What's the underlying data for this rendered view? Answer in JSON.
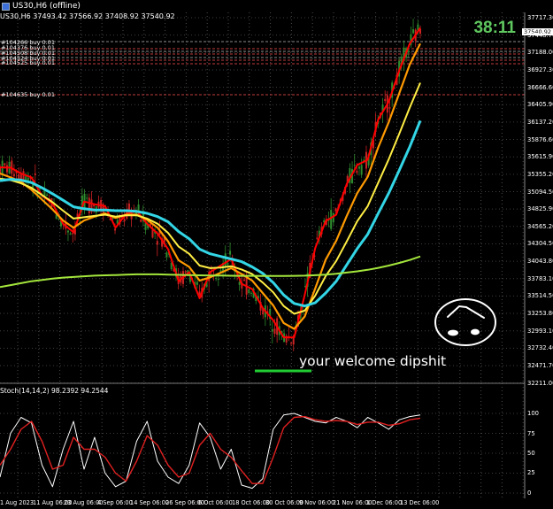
{
  "window": {
    "title": "US30,H6 (offline)",
    "ohlc": "US30,H6  37493.42 37566.92 37408.92 37540.92"
  },
  "timer": "38:11",
  "current_price": "37540.92",
  "order_labels": [
    "#104266 buy 0.01",
    "#104376 buy 0.01",
    "#104508 buy 0.01",
    "#104524 buy 0.01",
    "#104525 buy 0.01",
    "#104635 buy 0.01"
  ],
  "caption": "your welcome dipshit",
  "stoch_label": "Stoch(14,14,2) 98.2392 94.2544",
  "colors": {
    "background": "#000000",
    "up_candle": "#2e8b2e",
    "down_candle": "#cc2222",
    "ema_fast": "#ff0000",
    "ema_mid": "#ff9a00",
    "ema_slow": "#ffee44",
    "ma_cyan": "#33d6e6",
    "ma_long": "#a4e63c",
    "stoch_main": "#ffffff",
    "stoch_signal": "#e02020",
    "annotation": "#22cc33",
    "timer": "#5fc85f"
  },
  "chart_data": [
    {
      "type": "line",
      "title": "US30,H6 (offline)",
      "xlabel": "",
      "ylabel": "",
      "x_ticks": [
        "1 Aug 2023",
        "11 Aug 06:00",
        "23 Aug 06:00",
        "4 Sep 06:00",
        "14 Sep 06:00",
        "26 Sep 06:00",
        "6 Oct 06:00",
        "18 Oct 06:00",
        "30 Oct 06:00",
        "9 Nov 06:00",
        "21 Nov 06:00",
        "1 Dec 06:00",
        "13 Dec 06:00"
      ],
      "y_ticks": [
        "37717.30",
        "37448.70",
        "37188.00",
        "36927.30",
        "36666.60",
        "36405.90",
        "36137.20",
        "35876.60",
        "35615.90",
        "35355.20",
        "35094.50",
        "34825.90",
        "34565.20",
        "34304.50",
        "34043.80",
        "33783.10",
        "33514.50",
        "33253.80",
        "32993.10",
        "32732.40",
        "32471.70",
        "32211.00"
      ],
      "ylim": [
        32211,
        37717
      ],
      "series": [
        {
          "values": [
            35425,
            35420,
            35330,
            35270,
            34990,
            34870,
            34560,
            34430,
            34900,
            34860,
            34830,
            34500,
            34710,
            34760,
            34560,
            34410,
            34170,
            33680,
            33820,
            33420,
            33820,
            33920,
            34020,
            33640,
            33560,
            33270,
            33080,
            32820,
            32820,
            33470,
            34190,
            34600,
            34700,
            35170,
            35460,
            35540,
            36160,
            36430,
            36910,
            37320,
            37560
          ]
        },
        {
          "values": [
            35330,
            35270,
            35200,
            35080,
            34930,
            34780,
            34610,
            34500,
            34610,
            34670,
            34720,
            34650,
            34700,
            34700,
            34620,
            34500,
            34290,
            34000,
            33900,
            33690,
            33740,
            33810,
            33880,
            33790,
            33690,
            33500,
            33310,
            33040,
            32950,
            33140,
            33570,
            34010,
            34300,
            34680,
            35030,
            35280,
            35730,
            36120,
            36560,
            37000,
            37320
          ]
        },
        {
          "values": [
            35250,
            35230,
            35180,
            35110,
            35000,
            34890,
            34760,
            34640,
            34660,
            34680,
            34700,
            34670,
            34690,
            34690,
            34640,
            34560,
            34420,
            34210,
            34100,
            33920,
            33880,
            33890,
            33910,
            33860,
            33790,
            33660,
            33510,
            33300,
            33180,
            33230,
            33460,
            33760,
            33990,
            34290,
            34600,
            34830,
            35190,
            35550,
            35940,
            36340,
            36720
          ]
        },
        {
          "values": [
            35220,
            35240,
            35230,
            35190,
            35110,
            35020,
            34920,
            34820,
            34790,
            34770,
            34770,
            34760,
            34760,
            34750,
            34720,
            34670,
            34590,
            34440,
            34330,
            34170,
            34100,
            34060,
            34020,
            33980,
            33900,
            33800,
            33660,
            33470,
            33340,
            33300,
            33350,
            33500,
            33680,
            33930,
            34180,
            34400,
            34720,
            35030,
            35380,
            35740,
            36140
          ]
        },
        {
          "values": [
            33590,
            33620,
            33650,
            33680,
            33700,
            33720,
            33735,
            33745,
            33755,
            33765,
            33770,
            33775,
            33780,
            33785,
            33785,
            33785,
            33782,
            33778,
            33775,
            33770,
            33768,
            33766,
            33764,
            33763,
            33762,
            33761,
            33760,
            33760,
            33762,
            33765,
            33772,
            33782,
            33795,
            33812,
            33832,
            33855,
            33885,
            33920,
            33960,
            34005,
            34060
          ]
        }
      ]
    },
    {
      "type": "line",
      "title": "Stoch(14,14,2) 98.2392 94.2544",
      "y_ticks": [
        "100",
        "75",
        "50",
        "25",
        "0"
      ],
      "ylim": [
        0,
        100
      ],
      "series": [
        {
          "values": [
            20,
            75,
            95,
            88,
            35,
            8,
            55,
            90,
            30,
            70,
            25,
            8,
            15,
            65,
            90,
            40,
            20,
            12,
            35,
            88,
            70,
            30,
            55,
            10,
            6,
            18,
            80,
            98,
            100,
            95,
            90,
            88,
            95,
            90,
            82,
            95,
            88,
            80,
            92,
            96,
            98
          ]
        },
        {
          "values": [
            35,
            55,
            80,
            90,
            65,
            30,
            35,
            70,
            55,
            55,
            45,
            25,
            15,
            40,
            72,
            60,
            35,
            20,
            25,
            60,
            75,
            55,
            45,
            28,
            12,
            12,
            45,
            82,
            95,
            96,
            92,
            90,
            91,
            90,
            86,
            89,
            89,
            85,
            87,
            92,
            94
          ]
        }
      ]
    }
  ]
}
